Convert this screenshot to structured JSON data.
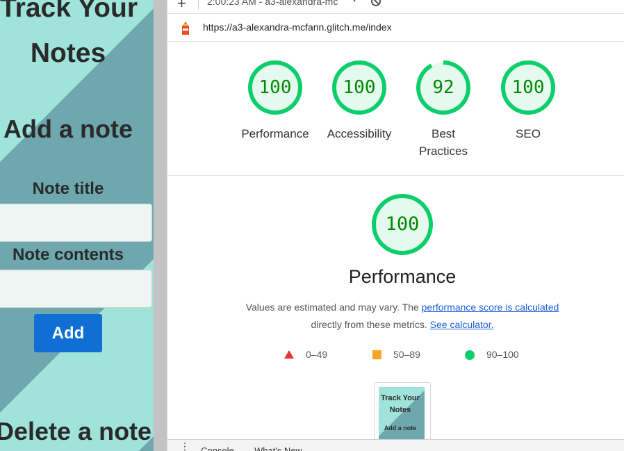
{
  "app": {
    "title_line1": "Track Your",
    "title_line2": "Notes",
    "add_heading": "Add a note",
    "note_title_label": "Note title",
    "note_contents_label": "Note contents",
    "add_button": "Add",
    "delete_heading": "Delete a note",
    "colors": {
      "light_stripe": "#9fe3da",
      "dark_stripe": "#6ea8ae",
      "button": "#0f6fd5"
    }
  },
  "devtools": {
    "toolbar": {
      "report_label": "2:00:23 AM - a3-alexandra-mc"
    },
    "url": "https://a3-alexandra-mcfann.glitch.me/index",
    "scores": [
      {
        "label": "Performance",
        "value": "100",
        "score": 100
      },
      {
        "label": "Accessibility",
        "value": "100",
        "score": 100
      },
      {
        "label": "Best Practices",
        "value": "92",
        "score": 92
      },
      {
        "label": "SEO",
        "value": "100",
        "score": 100
      }
    ],
    "performance": {
      "score": "100",
      "title": "Performance",
      "desc_prefix": "Values are estimated and may vary. The ",
      "desc_link": "performance score is calculated",
      "desc_middle": "directly from these metrics. ",
      "desc_link2": "See calculator."
    },
    "legend": [
      {
        "range": "0–49",
        "color": "#e53935",
        "shape": "triangle"
      },
      {
        "range": "50–89",
        "color": "#f5a623",
        "shape": "square"
      },
      {
        "range": "90–100",
        "color": "#0cce6b",
        "shape": "circle"
      }
    ],
    "thumbnail": {
      "title": "Track Your Notes",
      "subtitle": "Add a note"
    },
    "drawer_tabs": [
      "Console",
      "What's New"
    ],
    "colors": {
      "pass": "#0cce6b",
      "pass_text": "#008800",
      "pass_bg": "#e6f9ee"
    }
  }
}
